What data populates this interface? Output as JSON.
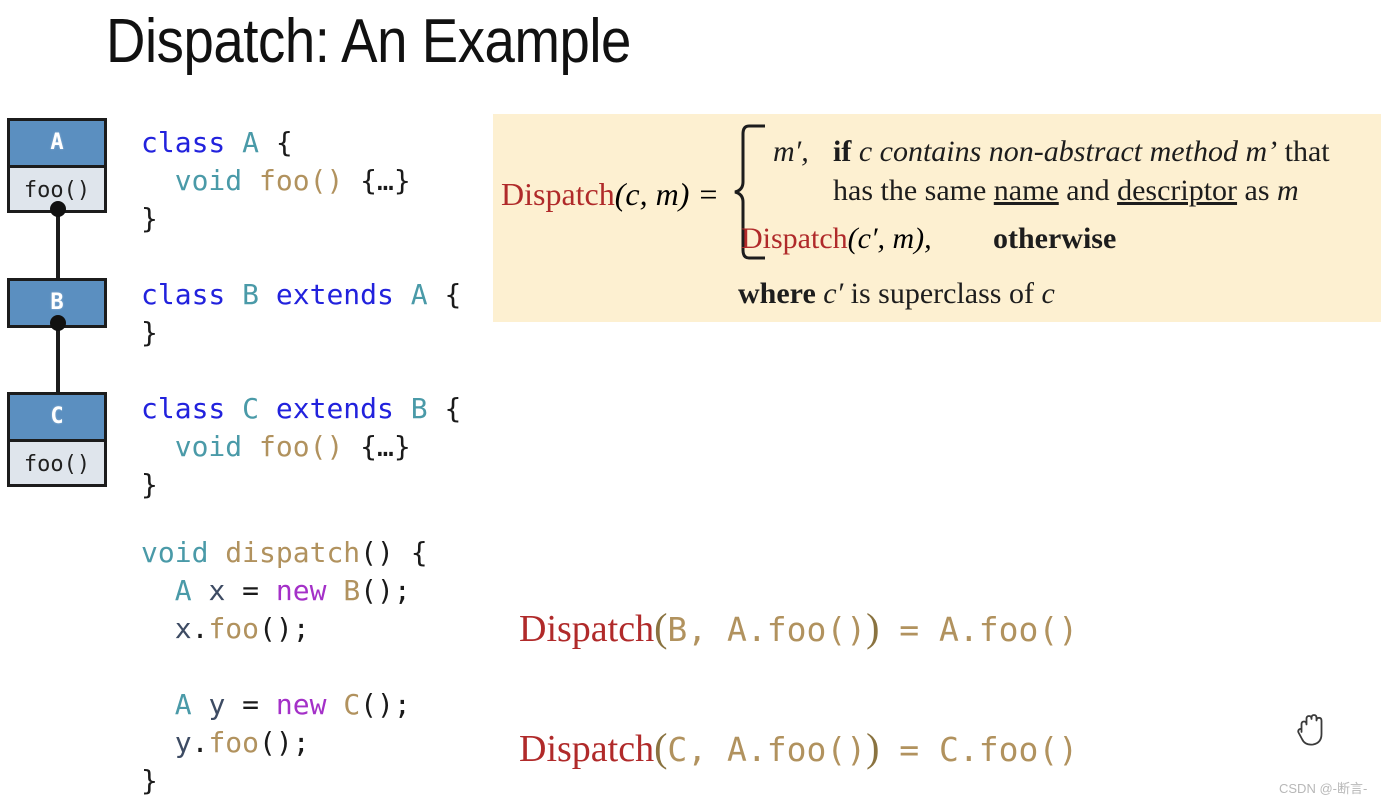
{
  "slide": {
    "title": "Dispatch: An Example"
  },
  "class_diagram": {
    "boxes": [
      {
        "name": "A",
        "method": "foo()"
      },
      {
        "name": "B",
        "method": ""
      },
      {
        "name": "C",
        "method": "foo()"
      }
    ]
  },
  "code_classes": {
    "lines": [
      "class A {",
      "  void foo() {…}",
      "}",
      "",
      "class B extends A {",
      "}",
      "",
      "class C extends B {",
      "  void foo() {…}",
      "}"
    ],
    "tokens": {
      "kw_class": "class",
      "kw_extends": "extends",
      "kw_void": "void",
      "name_a": "A",
      "name_b": "B",
      "name_c": "C",
      "fn_foo": "foo",
      "body": "{…}",
      "open_brace": "{",
      "close_brace": "}",
      "parens": "()"
    }
  },
  "code_dispatch": {
    "lines": [
      "void dispatch() {",
      "  A x = new B();",
      "  x.foo();",
      "",
      "  A y = new C();",
      "  y.foo();",
      "}"
    ],
    "tokens": {
      "kw_void": "void",
      "kw_new": "new",
      "fn_dispatch": "dispatch",
      "fn_foo": "foo",
      "type_a": "A",
      "type_b": "B",
      "type_c": "C",
      "var_x": "x",
      "var_y": "y",
      "equals": "=",
      "open_brace": "{",
      "close_brace": "}"
    }
  },
  "formula": {
    "lhs_name": "Dispatch",
    "lhs_args": "(c, m) =",
    "case1_value": "m′,",
    "case1_line1_if": "if",
    "case1_line1_rest_a": " c contains non-abstract method ",
    "case1_line1_mprime": "m’",
    "case1_line1_rest_b": " that",
    "case1_line2_a": "has the same ",
    "case1_line2_name": "name",
    "case1_line2_b": " and ",
    "case1_line2_descriptor": "descriptor",
    "case1_line2_c": " as ",
    "case1_line2_m": "m",
    "case2_name": "Dispatch",
    "case2_args": "(c′, m),",
    "case2_otherwise": "otherwise",
    "where_bold": "where",
    "where_rest_a": " c′ ",
    "where_rest_b": "is superclass of ",
    "where_rest_c": "c",
    "background_color": "#fdf0d1",
    "dispatch_color": "#b02a2a"
  },
  "equations": [
    {
      "name": "Dispatch",
      "open": "(",
      "arg_class": "B",
      "comma": ", ",
      "arg_method": "A.foo()",
      "close": ")",
      "equals": " = ",
      "result": "A.foo()"
    },
    {
      "name": "Dispatch",
      "open": "(",
      "arg_class": "C",
      "comma": ", ",
      "arg_method": "A.foo()",
      "close": ")",
      "equals": " = ",
      "result": "C.foo()"
    }
  ],
  "cursor": {
    "icon": "hand-grab-cursor"
  },
  "watermark": {
    "text": "CSDN @-断言-"
  }
}
